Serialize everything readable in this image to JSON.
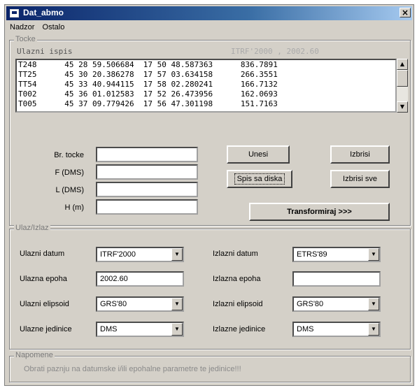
{
  "window": {
    "title": "Dat_abmo",
    "close_glyph": "×"
  },
  "menu": {
    "items": [
      {
        "label": "Nadzor"
      },
      {
        "label": "Ostalo"
      }
    ]
  },
  "tocke": {
    "group_label": "Tocke",
    "list_header": "Ulazni ispis",
    "list_header_right": "ITRF'2000 , 2002.60",
    "rows": [
      "T248      45 28 59.506684  17 50 48.587363      836.7891",
      "TT25      45 30 20.386278  17 57 03.634158      266.3551",
      "TT54      45 33 40.944115  17 58 02.280241      166.7132",
      "T002      45 36 01.012583  17 52 26.473956      162.0693",
      "T005      45 37 09.779426  17 56 47.301198      151.7163"
    ]
  },
  "inputs": {
    "br_tocke": {
      "label": "Br. tocke",
      "value": ""
    },
    "f_dms": {
      "label": "F (DMS)",
      "value": ""
    },
    "l_dms": {
      "label": "L (DMS)",
      "value": ""
    },
    "h_m": {
      "label": "H (m)",
      "value": ""
    }
  },
  "buttons": {
    "unesi": "Unesi",
    "izbrisi": "Izbrisi",
    "spis": "Spis sa diska",
    "izbrisi_sve": "Izbrisi sve",
    "transformiraj": "Transformiraj >>>"
  },
  "ulaz_izlaz": {
    "group_label": "Ulaz/Izlaz",
    "ulazni_datum": {
      "label": "Ulazni datum",
      "value": "ITRF'2000"
    },
    "izlazni_datum": {
      "label": "Izlazni datum",
      "value": "ETRS'89"
    },
    "ulazna_epoha": {
      "label": "Ulazna epoha",
      "value": "2002.60"
    },
    "izlazna_epoha": {
      "label": "Izlazna epoha",
      "value": ""
    },
    "ulazni_elipsoid": {
      "label": "Ulazni elipsoid",
      "value": "GRS'80"
    },
    "izlazni_elipsoid": {
      "label": "Izlazni elipsoid",
      "value": "GRS'80"
    },
    "ulazne_jedinice": {
      "label": "Ulazne jedinice",
      "value": "DMS"
    },
    "izlazne_jedinice": {
      "label": "Izlazne jedinice",
      "value": "DMS"
    }
  },
  "napomene": {
    "group_label": "Napomene",
    "text": "Obrati paznju na datumske i/ili epohalne parametre te jedinice!!!"
  },
  "icons": {
    "dropdown": "chevron-down-icon",
    "scroll_up": "scroll-up-icon",
    "scroll_down": "scroll-down-icon"
  },
  "colors": {
    "titlebar": "#0a246a",
    "face": "#d4d0c8"
  }
}
